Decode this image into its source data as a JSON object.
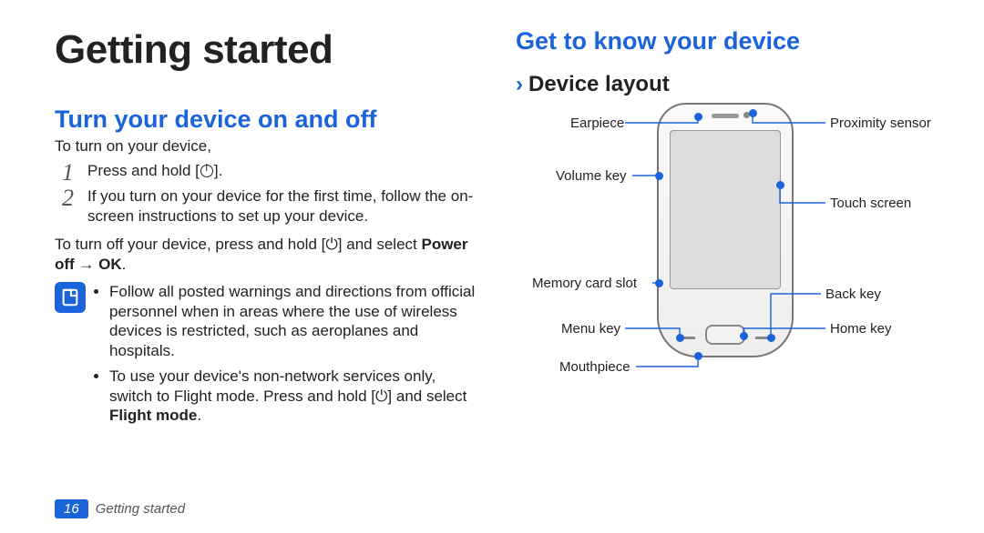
{
  "page": {
    "number": "16",
    "section": "Getting started",
    "title": "Getting started"
  },
  "left": {
    "heading": "Turn your device on and off",
    "intro": "To turn on your device,",
    "steps": [
      "Press and hold [⏻].",
      "If you turn on your device for the first time, follow the on-screen instructions to set up your device."
    ],
    "turnoff_prefix": "To turn off your device, press and hold [⏻] and select ",
    "turnoff_bold": "Power off → OK",
    "turnoff_suffix": ".",
    "notes": [
      "Follow all posted warnings and directions from official personnel when in areas where the use of wireless devices is restricted, such as aeroplanes and hospitals.",
      "To use your device's non-network services only, switch to Flight mode. Press and hold [⏻] and select "
    ],
    "note2_bold": "Flight mode",
    "note2_suffix": "."
  },
  "right": {
    "heading": "Get to know your device",
    "sub": "Device layout",
    "labels": {
      "earpiece": "Earpiece",
      "volume": "Volume key",
      "memcard": "Memory card slot",
      "menu": "Menu key",
      "mouth": "Mouthpiece",
      "prox": "Proximity sensor",
      "touch": "Touch screen",
      "back": "Back key",
      "home": "Home key"
    }
  }
}
